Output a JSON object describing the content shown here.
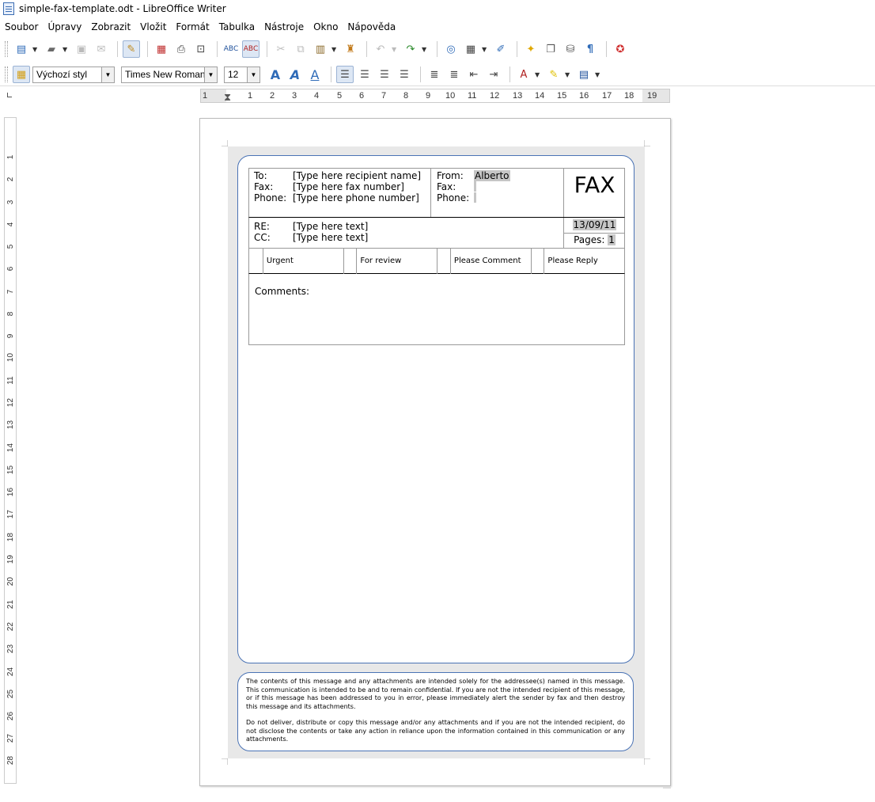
{
  "window": {
    "title": "simple-fax-template.odt - LibreOffice Writer"
  },
  "menu": [
    "Soubor",
    "Úpravy",
    "Zobrazit",
    "Vložit",
    "Formát",
    "Tabulka",
    "Nástroje",
    "Okno",
    "Nápověda"
  ],
  "formatting": {
    "paragraph_style": "Výchozí styl",
    "font_name": "Times New Roman",
    "font_size": "12"
  },
  "ruler": {
    "horizontal": [
      "1",
      "1",
      "2",
      "3",
      "4",
      "5",
      "6",
      "7",
      "8",
      "9",
      "10",
      "11",
      "12",
      "13",
      "14",
      "15",
      "16",
      "17",
      "18",
      "19"
    ],
    "vertical": [
      "1",
      "2",
      "3",
      "4",
      "5",
      "6",
      "7",
      "8",
      "9",
      "10",
      "11",
      "12",
      "13",
      "14",
      "15",
      "16",
      "17",
      "18",
      "19",
      "20",
      "21",
      "22",
      "23",
      "24",
      "25",
      "26",
      "27",
      "28"
    ]
  },
  "fax": {
    "to_label": "To:",
    "to_value": "[Type here recipient name]",
    "fax_label": "Fax:",
    "fax_value": "[Type here fax number]",
    "phone_label": "Phone:",
    "phone_value": "[Type here phone number]",
    "from_label": "From:",
    "from_value": "Alberto",
    "from_fax_label": "Fax:",
    "from_phone_label": "Phone:",
    "title": "FAX",
    "re_label": "RE:",
    "re_value": "[Type here text]",
    "cc_label": "CC:",
    "cc_value": "[Type here text]",
    "date": "13/09/11",
    "pages_label": "Pages:",
    "pages_value": "1",
    "checks": [
      "Urgent",
      "For review",
      "Please Comment",
      "Please Reply"
    ],
    "comments_label": "Comments:"
  },
  "disclaimer": [
    "The contents of this message and any attachments are intended solely for the addressee(s) named in this message. This communication is intended to be and to remain confidential. If you are not the intended recipient of this message, or if this message has been addressed to you in error, please immediately alert the sender by fax and then destroy this message and its attachments.",
    "Do not deliver, distribute or copy this message and/or any attachments and if you are not the intended recipient, do not disclose the contents or take any action in reliance upon the information contained in this communication or any attachments."
  ]
}
